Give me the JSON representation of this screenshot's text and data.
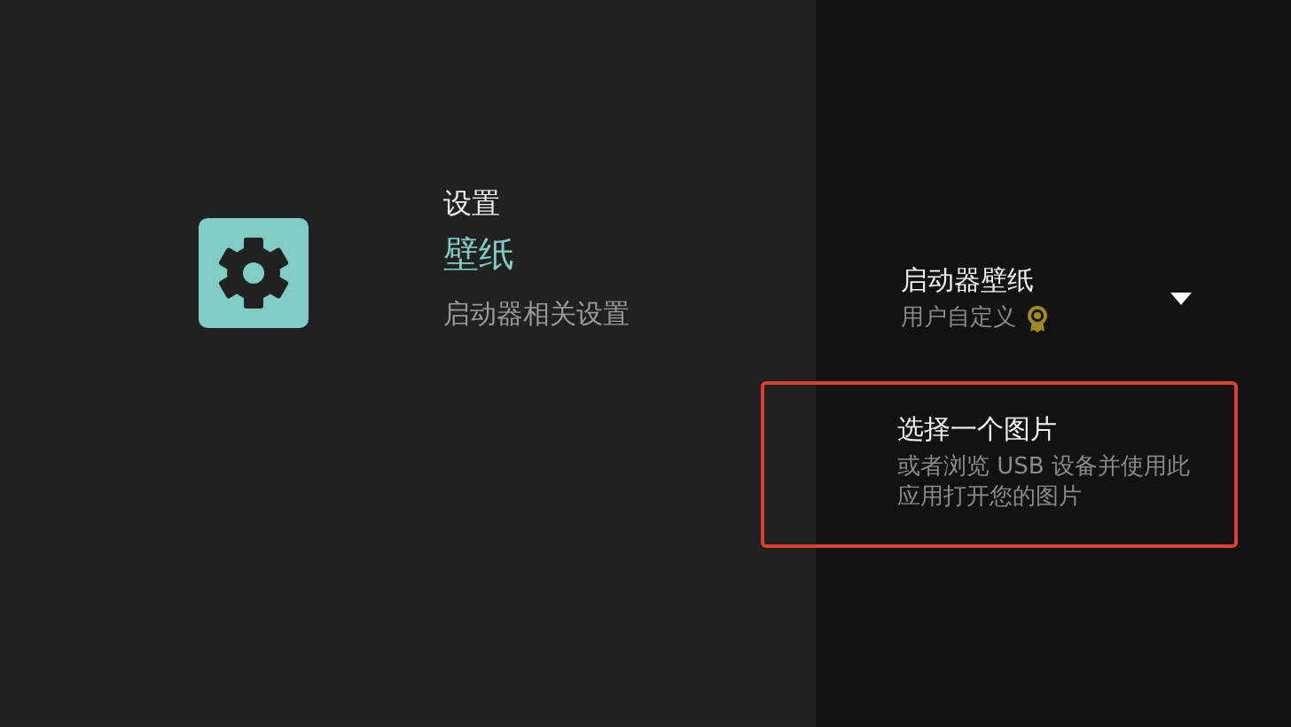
{
  "header": {
    "breadcrumb": "设置",
    "title": "壁纸",
    "subtitle": "启动器相关设置"
  },
  "settings": [
    {
      "kind": "dropdown",
      "title": "启动器壁纸",
      "value": "用户自定义",
      "expanded": false,
      "highlighted": false
    },
    {
      "kind": "action",
      "title": "选择一个图片",
      "description": "或者浏览 USB 设备并使用此应用打开您的图片",
      "highlighted": true
    }
  ]
}
